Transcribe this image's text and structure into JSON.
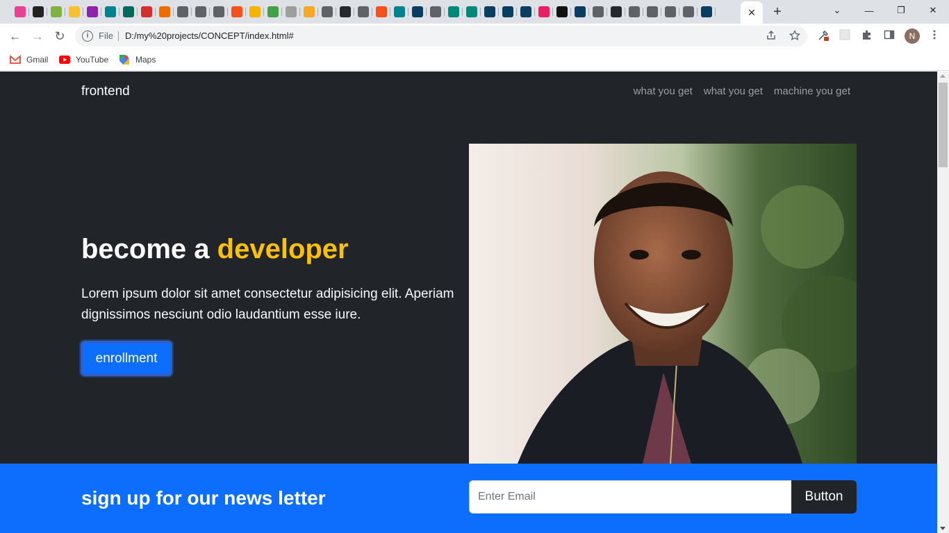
{
  "browser": {
    "tab_favicon_colors": [
      "#e84393",
      "#222222",
      "#7cb342",
      "#fbc02d",
      "#8e24aa",
      "#00838f",
      "#00695c",
      "#d32f2f",
      "#ef6c00",
      "#5f6368",
      "#5f6368",
      "#5f6368",
      "#f4511e",
      "#f4b400",
      "#43a047",
      "#9e9e9e",
      "#f9a825",
      "#5f6368",
      "#24292e",
      "#5f6368",
      "#f4511e",
      "#00838f",
      "#0a3d62",
      "#5f6368",
      "#00897b",
      "#00897b",
      "#0a3d62",
      "#0a3d62",
      "#0a3d62",
      "#e91e63",
      "#111111",
      "#0a3d62",
      "#5f6368",
      "#24292e",
      "#5f6368",
      "#5f6368",
      "#5f6368",
      "#5f6368",
      "#0a3d62"
    ],
    "active_tab_close": "✕",
    "new_tab": "+",
    "window_controls": {
      "minimize": "—",
      "restore": "❐",
      "close": "✕",
      "tab_search": "⌄"
    },
    "nav": {
      "back": "←",
      "forward": "→",
      "reload": "↻"
    },
    "address": {
      "scheme_label": "File",
      "url": "D:/my%20projects/CONCEPT/index.html#"
    },
    "profile_initial": "N",
    "bookmarks": [
      {
        "label": "Gmail",
        "icon": "gmail-icon",
        "color": "#ea4335"
      },
      {
        "label": "YouTube",
        "icon": "youtube-icon",
        "color": "#ff0000"
      },
      {
        "label": "Maps",
        "icon": "maps-icon",
        "color": "#34a853"
      }
    ]
  },
  "page": {
    "brand": "frontend",
    "nav_links": [
      "what you get",
      "what you get",
      "machine you get"
    ],
    "hero": {
      "headline_prefix": "become a",
      "headline_accent": "developer",
      "lead": "Lorem ipsum dolor sit amet consectetur adipisicing elit. Aperiam dignissimos nesciunt odio laudantium esse iure.",
      "cta_label": "enrollment"
    },
    "newsletter": {
      "title": "sign up for our news letter",
      "email_placeholder": "Enter Email",
      "button_label": "Button"
    }
  },
  "colors": {
    "hero_bg": "#212529",
    "accent": "#ffc107",
    "primary": "#0d6efd"
  }
}
